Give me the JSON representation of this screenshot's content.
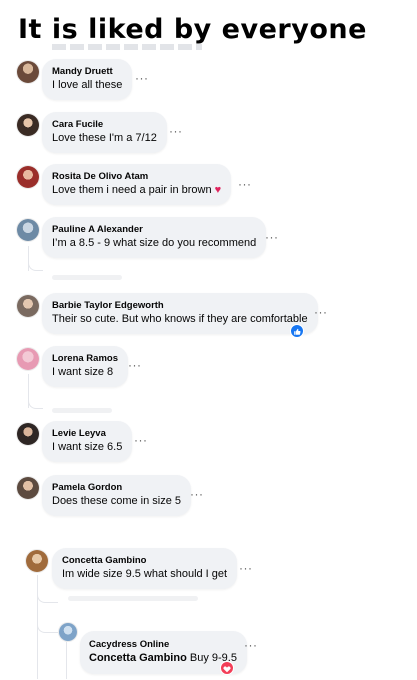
{
  "headline": "It is liked by everyone",
  "comments": [
    {
      "name": "Mandy Druett",
      "text": "I love all these",
      "more": "···"
    },
    {
      "name": "Cara Fucile",
      "text": "Love these I'm a 7/12",
      "more": "···"
    },
    {
      "name": "Rosita De Olivo Atam",
      "text": "Love them i need a pair in brown",
      "emoji": "♥",
      "more": "···"
    },
    {
      "name": "Pauline A Alexander",
      "text": "I’m a 8.5 - 9 what size do you recommend",
      "more": "···"
    },
    {
      "name": "Barbie Taylor Edgeworth",
      "text": "Their so cute. But who knows if they are comfortable",
      "reaction": "like",
      "more": "···"
    },
    {
      "name": "Lorena Ramos",
      "text": "I want size 8",
      "more": "···"
    },
    {
      "name": "Levie Leyva",
      "text": "I want size 6.5",
      "more": "···"
    },
    {
      "name": "Pamela Gordon",
      "text": "Does these come in size 5",
      "more": "···"
    },
    {
      "name": "Concetta Gambino",
      "text": "Im wide size 9.5 what should I get",
      "more": "···"
    }
  ],
  "reply": {
    "name": "Cacydress Online",
    "mention": "Concetta Gambino",
    "text": "Buy 9-9.5",
    "reaction": "love",
    "more": "···"
  },
  "colors": {
    "bubble": "#f0f2f5",
    "like": "#1877f2",
    "love": "#f33e58",
    "heart": "#e0245e"
  }
}
